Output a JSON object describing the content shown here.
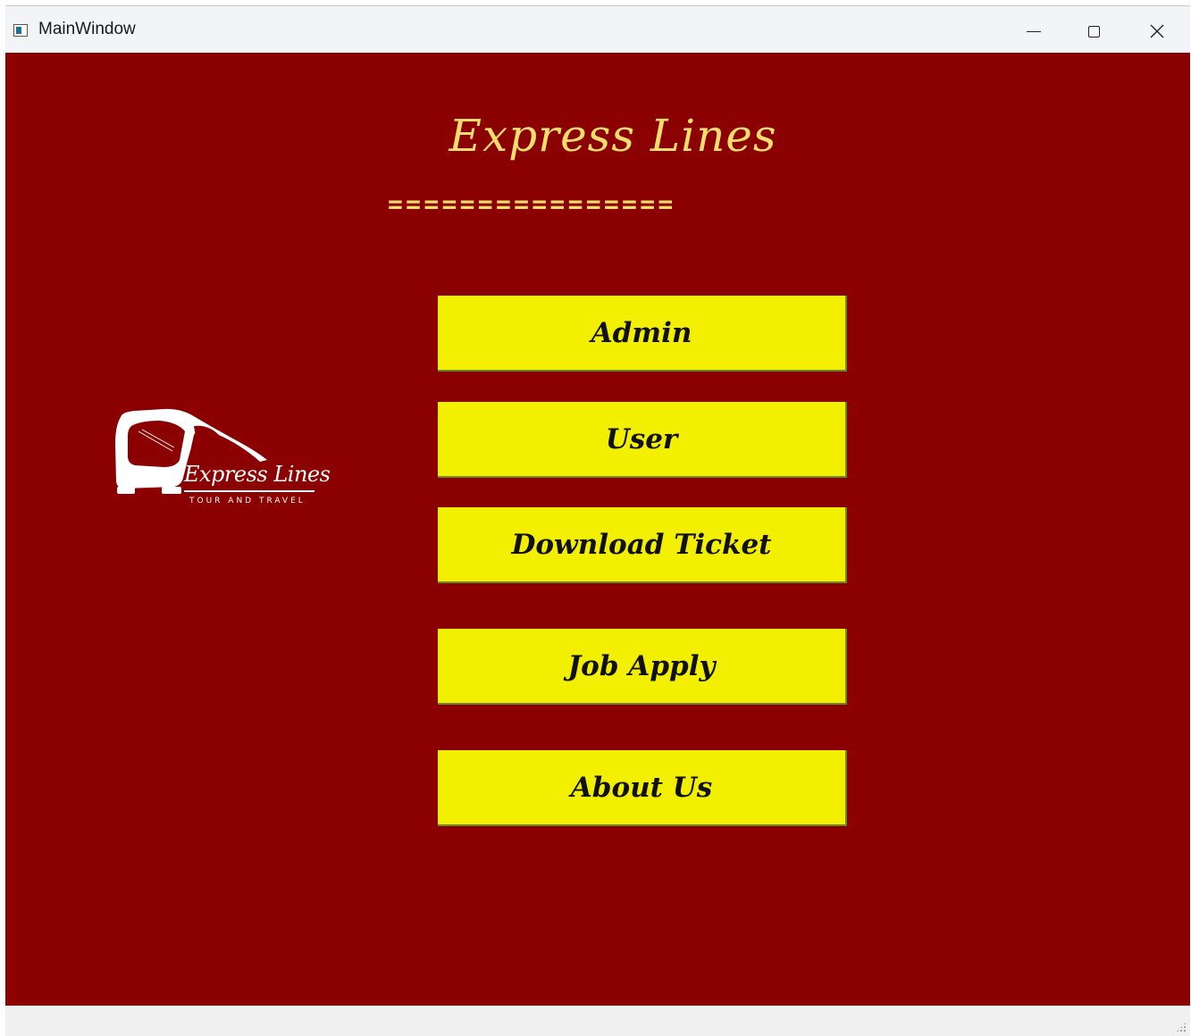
{
  "window": {
    "title": "MainWindow",
    "icon": "app-window-icon"
  },
  "titlebar_buttons": {
    "minimize": "minimize-icon",
    "maximize": "maximize-icon",
    "close": "close-icon"
  },
  "header": {
    "title": "Express Lines",
    "divider": "================"
  },
  "logo": {
    "name": "Express Lines",
    "tagline": "TOUR AND TRAVEL",
    "icon": "bus-icon"
  },
  "menu": {
    "admin": "Admin",
    "user": "User",
    "download_ticket": "Download Ticket",
    "job_apply": "Job Apply",
    "about_us": "About Us"
  },
  "colors": {
    "background": "#8b0000",
    "accent_text": "#f6de6c",
    "button_bg": "#f2ef00",
    "button_text": "#111111",
    "logo": "#ffffff"
  }
}
